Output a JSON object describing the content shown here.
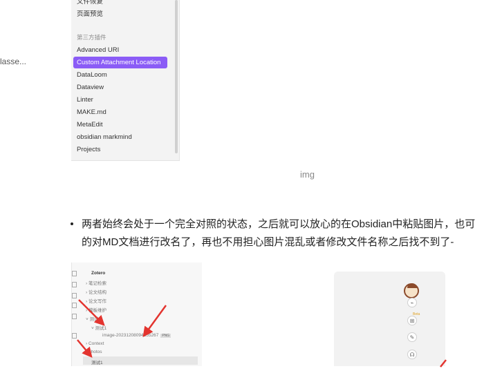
{
  "left_fragment": "lasse...",
  "settings_panel": {
    "top_items": [
      "文件恢复",
      "页面预览"
    ],
    "group_label": "第三方插件",
    "items": [
      "Advanced URI",
      "Custom Attachment Location",
      "DataLoom",
      "Dataview",
      "Linter",
      "MAKE.md",
      "MetaEdit",
      "obsidian markmind",
      "Projects"
    ],
    "active_index": 1
  },
  "image_caption": "img",
  "bullet": {
    "line1": "两者始终会处于一个完全对照的状态，之后就可以放心的在Obsidian中粘贴图片，也可",
    "line2": "的对MD文档进行改名了，再也不用担心图片混乱或者修改文件名称之后找不到了-"
  },
  "tree": {
    "root": "Zotero",
    "rows": [
      "笔记检索",
      "论文结构",
      "论文写作",
      "模板维护",
      "测试",
      "测试1"
    ],
    "image_file": "image-20231208094255267",
    "image_tag": "PNG",
    "context": "Context",
    "photos": "photos",
    "selected": "测试1"
  },
  "side_panel": {
    "beta": "Beta"
  },
  "colors": {
    "accent": "#8b5cf6",
    "arrow": "#e3342f"
  }
}
